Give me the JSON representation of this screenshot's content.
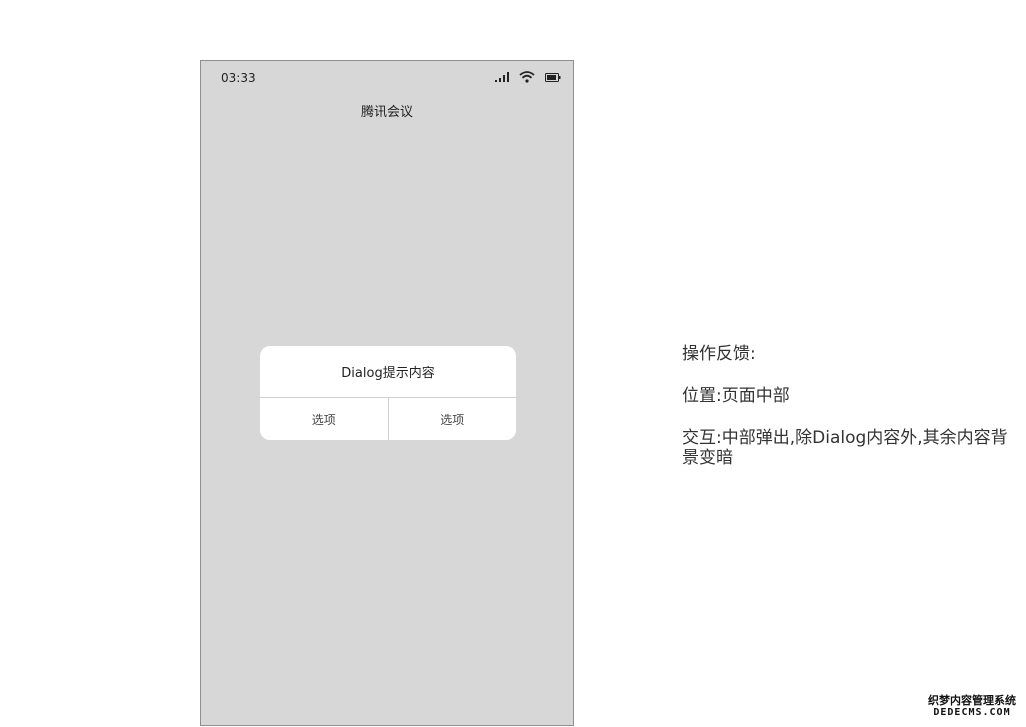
{
  "phone": {
    "status_bar": {
      "time": "03:33",
      "icons": [
        "signal-icon",
        "wifi-icon",
        "battery-icon"
      ]
    },
    "app_title": "腾讯会议",
    "background_color": "#d7d7d7"
  },
  "dialog": {
    "content": "Dialog提示内容",
    "buttons": [
      {
        "label": "选项"
      },
      {
        "label": "选项"
      }
    ]
  },
  "notes": {
    "feedback": "操作反馈:",
    "position": "位置:页面中部",
    "interaction": "交互:中部弹出,除Dialog内容外,其余内容背景变暗"
  },
  "watermark": {
    "cn": "织梦内容管理系统",
    "en": "DEDECMS.COM"
  }
}
